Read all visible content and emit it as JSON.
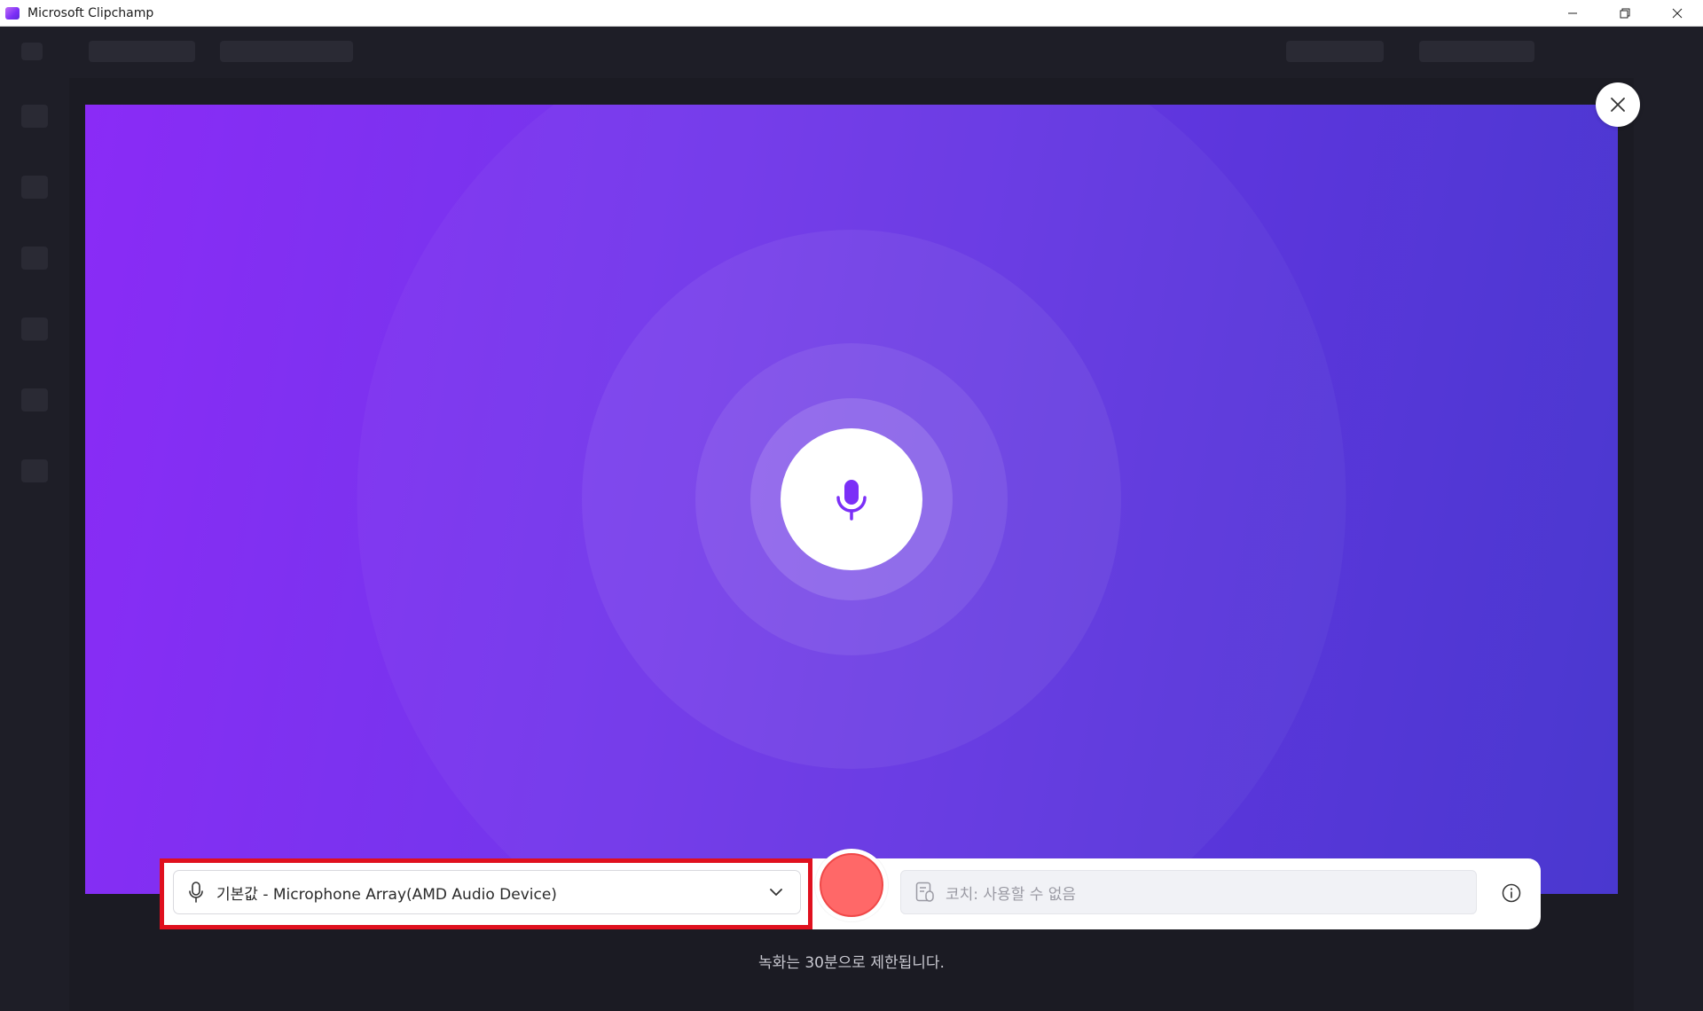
{
  "window": {
    "title": "Microsoft Clipchamp",
    "controls": [
      "minimize",
      "restore",
      "close"
    ]
  },
  "recorder": {
    "microphone_select": {
      "value": "기본값 - Microphone Array(AMD Audio Device)",
      "icon": "microphone-icon"
    },
    "record_button_color": "#ff6868",
    "coach_field": {
      "text": "코치: 사용할 수 없음",
      "icon": "speaker-notes-icon"
    },
    "limit_note": "녹화는 30분으로 제한됩니다."
  },
  "colors": {
    "gradient_start": "#8a2bf6",
    "gradient_end": "#4a38cf",
    "mic_icon": "#7b2ff7",
    "highlight_border": "#e0101e"
  }
}
